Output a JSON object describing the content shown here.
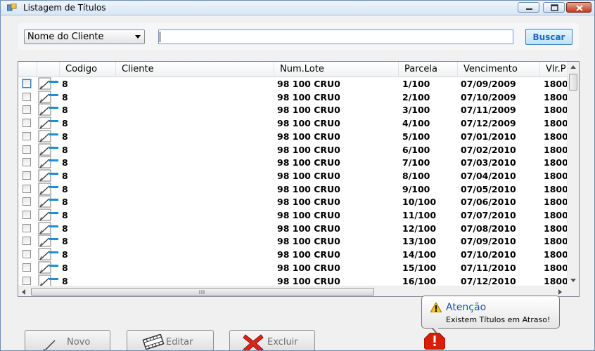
{
  "window": {
    "title": "Listagem de Títulos"
  },
  "search": {
    "filter_selected": "Nome do Cliente",
    "query_value": "",
    "search_button": "Buscar"
  },
  "grid": {
    "columns": [
      "Codigo",
      "Cliente",
      "Num.Lote",
      "Parcela",
      "Vencimento",
      "Vlr.P"
    ],
    "rows": [
      {
        "codigo": "8",
        "cliente": "",
        "lote": "98 100 CRU0",
        "parcela": "1/100",
        "vencimento": "07/09/2009",
        "valor": "1800"
      },
      {
        "codigo": "8",
        "cliente": "",
        "lote": "98 100 CRU0",
        "parcela": "2/100",
        "vencimento": "07/10/2009",
        "valor": "1800"
      },
      {
        "codigo": "8",
        "cliente": "",
        "lote": "98 100 CRU0",
        "parcela": "3/100",
        "vencimento": "07/11/2009",
        "valor": "1800"
      },
      {
        "codigo": "8",
        "cliente": "",
        "lote": "98 100 CRU0",
        "parcela": "4/100",
        "vencimento": "07/12/2009",
        "valor": "1800"
      },
      {
        "codigo": "8",
        "cliente": "",
        "lote": "98 100 CRU0",
        "parcela": "5/100",
        "vencimento": "07/01/2010",
        "valor": "1800"
      },
      {
        "codigo": "8",
        "cliente": "",
        "lote": "98 100 CRU0",
        "parcela": "6/100",
        "vencimento": "07/02/2010",
        "valor": "1800"
      },
      {
        "codigo": "8",
        "cliente": "",
        "lote": "98 100 CRU0",
        "parcela": "7/100",
        "vencimento": "07/03/2010",
        "valor": "1800"
      },
      {
        "codigo": "8",
        "cliente": "",
        "lote": "98 100 CRU0",
        "parcela": "8/100",
        "vencimento": "07/04/2010",
        "valor": "1800"
      },
      {
        "codigo": "8",
        "cliente": "",
        "lote": "98 100 CRU0",
        "parcela": "9/100",
        "vencimento": "07/05/2010",
        "valor": "1800"
      },
      {
        "codigo": "8",
        "cliente": "",
        "lote": "98 100 CRU0",
        "parcela": "10/100",
        "vencimento": "07/06/2010",
        "valor": "1800"
      },
      {
        "codigo": "8",
        "cliente": "",
        "lote": "98 100 CRU0",
        "parcela": "11/100",
        "vencimento": "07/07/2010",
        "valor": "1800"
      },
      {
        "codigo": "8",
        "cliente": "",
        "lote": "98 100 CRU0",
        "parcela": "12/100",
        "vencimento": "07/08/2010",
        "valor": "1800"
      },
      {
        "codigo": "8",
        "cliente": "",
        "lote": "98 100 CRU0",
        "parcela": "13/100",
        "vencimento": "07/09/2010",
        "valor": "1800"
      },
      {
        "codigo": "8",
        "cliente": "",
        "lote": "98 100 CRU0",
        "parcela": "14/100",
        "vencimento": "07/10/2010",
        "valor": "1800"
      },
      {
        "codigo": "8",
        "cliente": "",
        "lote": "98 100 CRU0",
        "parcela": "15/100",
        "vencimento": "07/11/2010",
        "valor": "1800"
      },
      {
        "codigo": "8",
        "cliente": "",
        "lote": "98 100 CRU0",
        "parcela": "16/100",
        "vencimento": "07/12/2010",
        "valor": "1800"
      }
    ]
  },
  "alert": {
    "title": "Atenção",
    "message": "Existem Títulos em Atraso!"
  },
  "buttons": {
    "novo": "Novo",
    "editar": "Editar",
    "excluir": "Excluir"
  },
  "colors": {
    "accent": "#1f67c9",
    "edit_icon": "#1c8fd6",
    "error": "#d81e05",
    "warning": "#f4c11a"
  },
  "icons": [
    "app-icon",
    "minimize-icon",
    "maximize-icon",
    "close-icon",
    "edit-pencil-icon",
    "warning-icon",
    "error-icon",
    "film-edit-icon",
    "delete-x-icon"
  ]
}
